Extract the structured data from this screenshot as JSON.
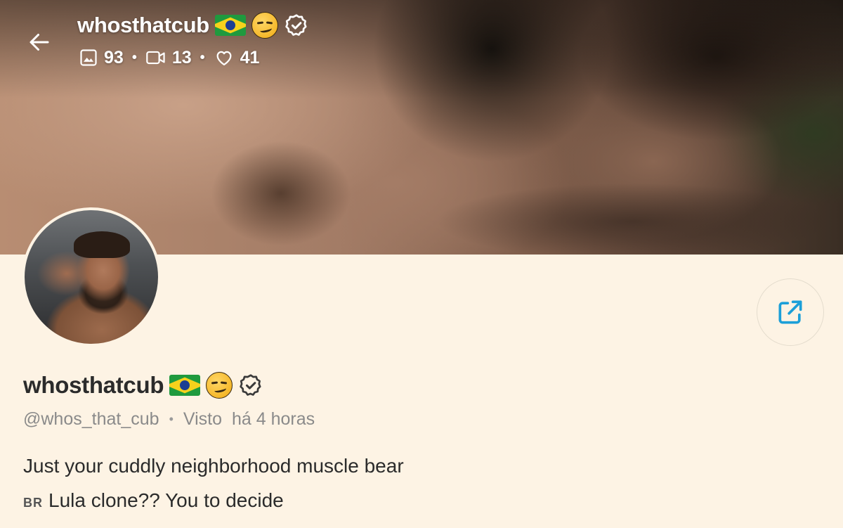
{
  "header": {
    "username": "whosthatcub",
    "stats": {
      "photos": "93",
      "videos": "13",
      "likes": "41"
    }
  },
  "profile": {
    "display_name": "whosthatcub",
    "handle": "@whos_that_cub",
    "seen_label": "Visto",
    "last_seen": "há 4 horas",
    "bio_line1": "Just your cuddly neighborhood muscle bear",
    "bio_line2_flag": "BR",
    "bio_line2": "Lula clone?? You to decide"
  },
  "icons": {
    "back": "arrow-left-icon",
    "photos": "image-icon",
    "videos": "video-icon",
    "likes": "heart-icon",
    "share": "share-icon",
    "verified": "verified-badge-icon",
    "flag": "brazil-flag-icon",
    "emoji": "smirk-emoji-icon"
  },
  "colors": {
    "background": "#fdf3e4",
    "accent": "#1c9fd8",
    "text_primary": "#2b2b2b",
    "text_secondary": "#8a8a8a"
  }
}
